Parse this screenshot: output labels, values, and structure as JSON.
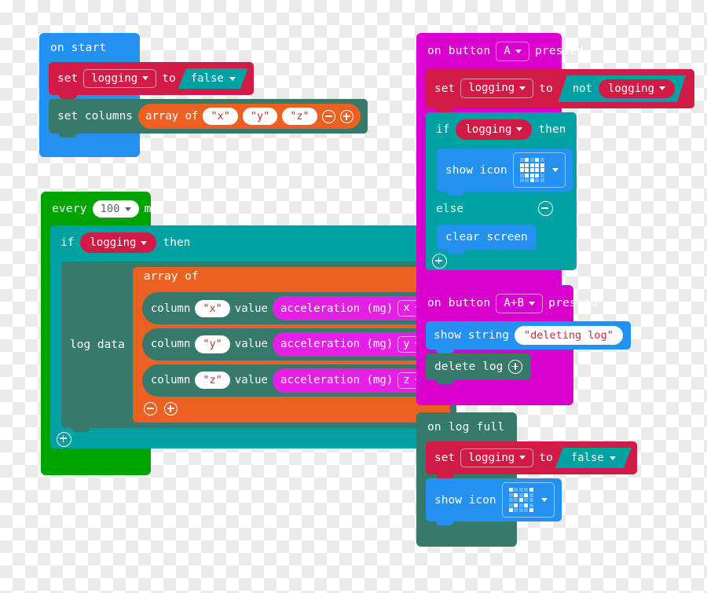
{
  "theme": {
    "event_blue": "#2490f0",
    "event_magenta": "#d900ce",
    "loops_green": "#00a400",
    "logic_teal": "#00a1a3",
    "variables_red": "#d11b46",
    "datalog_green": "#357a6b",
    "arrays_orange": "#ec6022",
    "input_magenta": "#e61fe6",
    "basic_blue": "#2490f0",
    "text_white": "#ffffff"
  },
  "stacks": {
    "on_start": {
      "hat_label": "on start",
      "set_logging": {
        "set": "set",
        "variable": "logging",
        "to": "to",
        "value": "false"
      },
      "set_columns": {
        "label": "set columns",
        "array_of": "array of",
        "items": [
          "\"x\"",
          "\"y\"",
          "\"z\""
        ]
      }
    },
    "every_ms": {
      "every": "every",
      "interval": "100",
      "unit": "ms",
      "if": "if",
      "condition": "logging",
      "then": "then",
      "log_data": "log data",
      "array_of": "array of",
      "rows": [
        {
          "column": "column",
          "name": "\"x\"",
          "value": "value",
          "reporter": "acceleration (mg)",
          "axis": "x"
        },
        {
          "column": "column",
          "name": "\"y\"",
          "value": "value",
          "reporter": "acceleration (mg)",
          "axis": "y"
        },
        {
          "column": "column",
          "name": "\"z\"",
          "value": "value",
          "reporter": "acceleration (mg)",
          "axis": "z"
        }
      ]
    },
    "on_button_a": {
      "on_button": "on button",
      "button": "A",
      "pressed": "pressed",
      "set": "set",
      "variable": "logging",
      "to": "to",
      "not": "not",
      "not_operand": "logging",
      "if": "if",
      "condition": "logging",
      "then": "then",
      "show_icon": "show icon",
      "icon_name": "heart-icon",
      "icon_matrix": [
        [
          0,
          1,
          0,
          1,
          0
        ],
        [
          1,
          1,
          1,
          1,
          1
        ],
        [
          1,
          1,
          1,
          1,
          1
        ],
        [
          0,
          1,
          1,
          1,
          0
        ],
        [
          0,
          0,
          1,
          0,
          0
        ]
      ],
      "else": "else",
      "clear_screen": "clear screen"
    },
    "on_button_ab": {
      "on_button": "on button",
      "button": "A+B",
      "pressed": "pressed",
      "show_string": "show string",
      "string_value": "\"deleting log\"",
      "delete_log": "delete log"
    },
    "on_log_full": {
      "hat_label": "on log full",
      "set": "set",
      "variable": "logging",
      "to": "to",
      "value": "false",
      "show_icon": "show icon",
      "icon_name": "no-icon",
      "icon_matrix": [
        [
          1,
          0,
          0,
          0,
          1
        ],
        [
          0,
          1,
          0,
          1,
          0
        ],
        [
          0,
          0,
          1,
          0,
          0
        ],
        [
          0,
          1,
          0,
          1,
          0
        ],
        [
          1,
          0,
          0,
          0,
          1
        ]
      ]
    }
  }
}
